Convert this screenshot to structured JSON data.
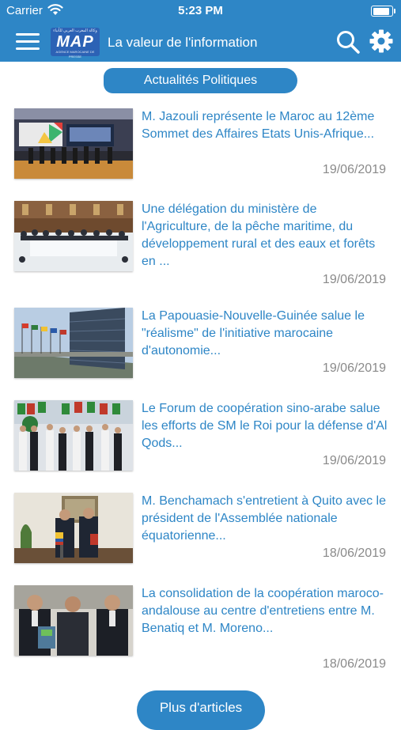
{
  "status_bar": {
    "carrier": "Carrier",
    "time": "5:23 PM",
    "battery_level": 1.0
  },
  "navbar": {
    "logo": {
      "text": "MAP",
      "arabic": "وكالة المغرب العربي للأنباء",
      "subtitle": "AGENCE MAROCAINE DE PRESSE"
    },
    "tagline": "La valeur de l'information",
    "icons": [
      "menu-icon",
      "search-icon",
      "gear-icon"
    ]
  },
  "category": "Actualités Politiques",
  "articles": [
    {
      "title": "M. Jazouli représente le Maroc au 12ème Sommet des Affaires Etats Unis-Afrique...",
      "date": "19/06/2019"
    },
    {
      "title": "Une délégation du ministère de l'Agriculture, de la pêche maritime, du développement rural et des eaux et forêts en ...",
      "date": "19/06/2019"
    },
    {
      "title": "La Papouasie-Nouvelle-Guinée salue le \"réalisme\" de l'initiative marocaine d'autonomie...",
      "date": "19/06/2019"
    },
    {
      "title": "Le Forum de coopération sino-arabe salue les efforts de SM le Roi pour la défense d'Al Qods...",
      "date": "19/06/2019"
    },
    {
      "title": "M. Benchamach s'entretient à Quito avec le président de l'Assemblée nationale équatorienne...",
      "date": "18/06/2019"
    },
    {
      "title": "La consolidation de la coopération maroco-andalouse au centre d'entretiens entre M. Benatiq et M. Moreno...",
      "date": "18/06/2019"
    }
  ],
  "more_button": "Plus d'articles",
  "colors": {
    "primary": "#2e86c6",
    "date_text": "#8a8a8a",
    "background": "#ffffff"
  }
}
